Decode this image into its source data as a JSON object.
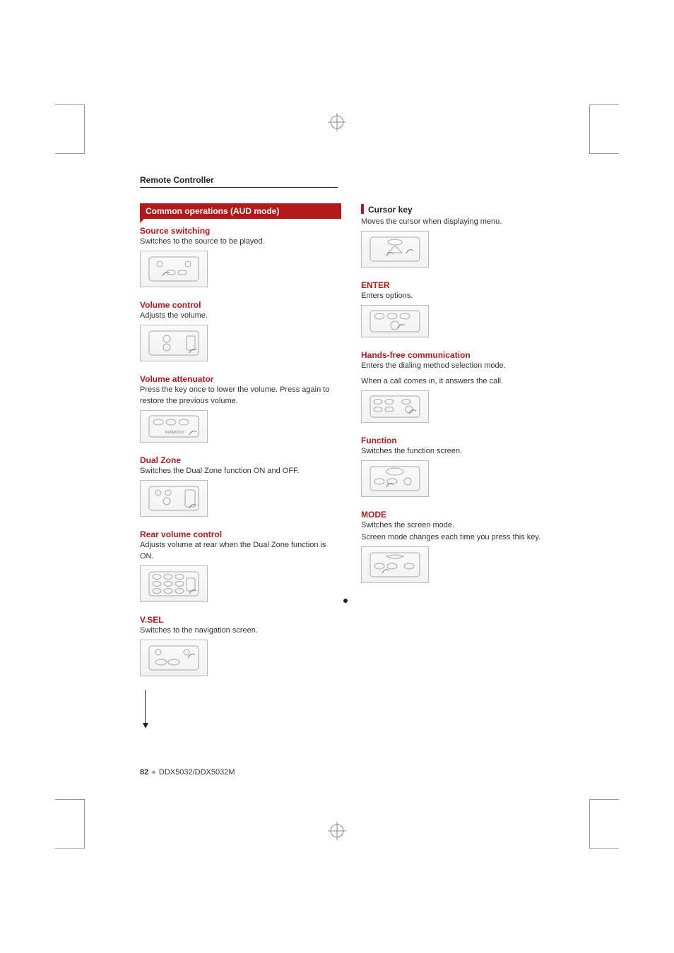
{
  "header": "Remote Controller",
  "banner": "Common operations (AUD mode)",
  "left": [
    {
      "title": "Source switching",
      "red": true,
      "body": [
        "Switches to the source to be played."
      ]
    },
    {
      "title": "Volume control",
      "red": true,
      "body": [
        "Adjusts the volume."
      ]
    },
    {
      "title": "Volume attenuator",
      "red": true,
      "body": [
        "Press the key once to lower the volume. Press again to restore the previous volume."
      ]
    },
    {
      "title": "Dual Zone",
      "red": true,
      "body": [
        "Switches the Dual Zone function ON and OFF."
      ]
    },
    {
      "title": "Rear volume control",
      "red": true,
      "body": [
        "Adjusts volume at rear when the Dual Zone function is ON."
      ]
    },
    {
      "title": "V.SEL",
      "red": true,
      "body": [
        "Switches to the navigation screen."
      ]
    }
  ],
  "right": [
    {
      "title": "Cursor key",
      "red": true,
      "body": [
        "Moves the cursor when displaying menu."
      ]
    },
    {
      "title": "ENTER",
      "red": true,
      "body": [
        "Enters options."
      ]
    },
    {
      "title": "Hands-free communication",
      "red": true,
      "body": [
        "Enters the dialing method selection mode.",
        "When a call comes in, it answers the call."
      ]
    },
    {
      "title": "Function",
      "red": true,
      "body": [
        "Switches the function screen."
      ]
    },
    {
      "title": "MODE",
      "red": true,
      "body": [
        "Switches the screen mode.",
        "Screen mode changes each time you press this key."
      ]
    }
  ],
  "footer": {
    "page": "82",
    "model": "DDX5032/DDX5032M"
  }
}
